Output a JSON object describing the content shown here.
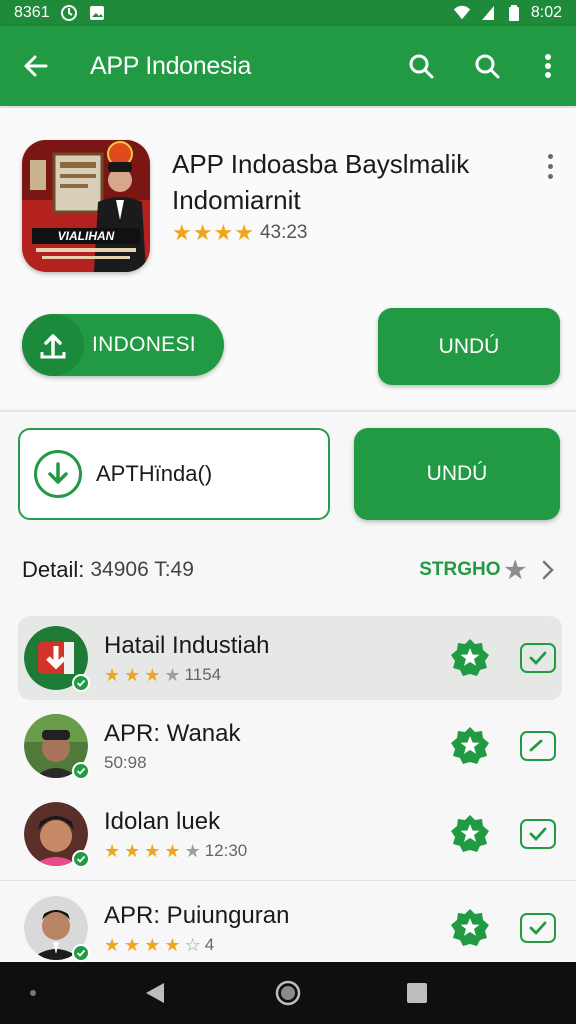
{
  "status_bar": {
    "time_left": "8361",
    "time_right": "8:02"
  },
  "app_bar": {
    "title": "APP Indonesia"
  },
  "app": {
    "name_line1": "APP  Indoasba Bayslmalik",
    "name_line2": "Indomiarnit",
    "rating_count": "43:23",
    "rating_stars": 4,
    "icon_banner_text": "VIALIHAN"
  },
  "buttons": {
    "indonesi_label": "INDONESI",
    "undu_label": "UNDÚ",
    "secondary_label": "APTHïnda()",
    "undu2_label": "UNDÚ"
  },
  "detail": {
    "label": "Detail:",
    "value": "34906 T:49",
    "link": "STRGHO"
  },
  "list": [
    {
      "title": "Hatail Industiah",
      "sub": "1154",
      "stars": 3.5,
      "active": true
    },
    {
      "title": "APR: Wanak",
      "sub": "50:98",
      "stars": 0,
      "active": false
    },
    {
      "title": "Idolan luek",
      "sub": "12:30",
      "stars": 4,
      "active": false
    },
    {
      "title": "APR: Puiunguran",
      "sub": "4",
      "stars": 4,
      "active": false
    }
  ],
  "colors": {
    "primary": "#219a43",
    "star": "#f1a51c"
  }
}
